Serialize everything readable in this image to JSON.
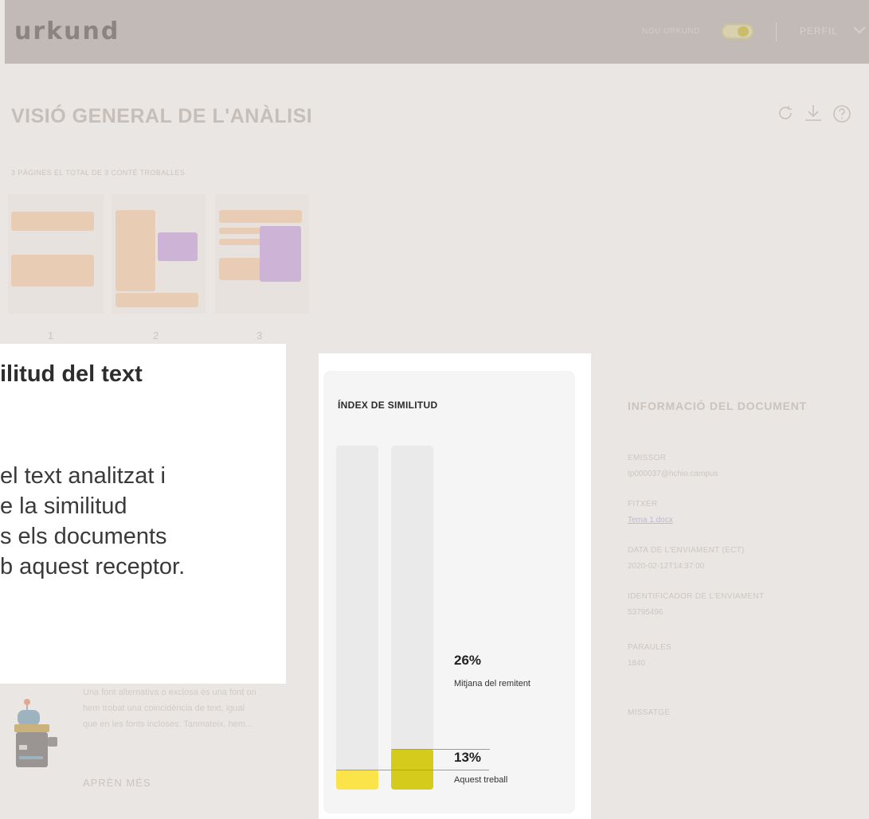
{
  "header": {
    "logo": "urkund",
    "nou_label": "NOU URKUND",
    "perfil": "PERFIL"
  },
  "page": {
    "title": "VISIÓ GENERAL DE L'ANÀLISI",
    "pages_info": "3 PÀGINES EL TOTAL DE 3 CONTÉ TROBALLES",
    "page_numbers": [
      "1",
      "2",
      "3"
    ]
  },
  "tutorial": {
    "title": "ilitud del text",
    "lines": [
      "el text analitzat i",
      "e la similitud",
      "s els documents",
      "b aquest receptor."
    ]
  },
  "alternative_source": {
    "text": "Una font alternativa o exclosa és una font on hem trobat una coincidència de text, igual que en les fonts incloses. Tanmateix, hem...",
    "learn_more": "APRÈN MÉS"
  },
  "similarity": {
    "title": "ÍNDEX DE SIMILITUD",
    "submitter_avg_pct": "26%",
    "submitter_avg_label": "Mitjana del remitent",
    "this_work_pct": "13%",
    "this_work_label": "Aquest treball",
    "bar_submitter_avg_fraction": 0.26,
    "bar_this_work_fraction": 0.13,
    "colors": {
      "this_work": "#fbe44a",
      "submitter_avg": "#d4cb1d"
    }
  },
  "doc_info": {
    "title": "INFORMACIÓ DEL DOCUMENT",
    "emissor_label": "EMISSOR",
    "emissor_value": "tp000037@hchio.campus",
    "fitxer_label": "FITXER",
    "fitxer_value": "Tema 1.docx",
    "data_label": "DATA DE L'ENVIAMENT (ECT)",
    "data_value": "2020-02-12T14:37:00",
    "id_label": "IDENTIFICADOR DE L'ENVIAMENT",
    "id_value": "53795496",
    "paraules_label": "PARAULES",
    "paraules_value": "1840",
    "missatge_label": "MISSATGE"
  }
}
